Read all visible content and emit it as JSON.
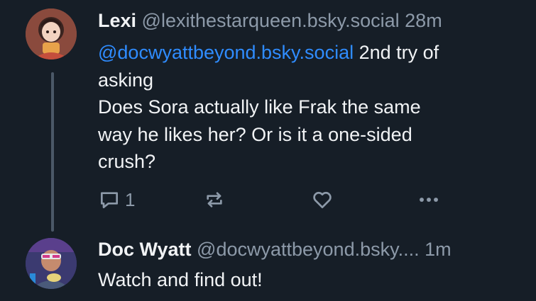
{
  "posts": [
    {
      "author": {
        "display_name": "Lexi",
        "handle": "@lexithestarqueen.bsky.social",
        "time": "28m"
      },
      "mention": "@docwyattbeyond.bsky.social",
      "text_line_1": " 2nd try of",
      "text_lines": [
        "asking",
        "Does Sora actually like Frak the same",
        "way he likes her? Or is it a one-sided",
        "crush?"
      ],
      "reply_count": "1",
      "icons": [
        "reply-icon",
        "repost-icon",
        "like-icon",
        "more-icon"
      ]
    },
    {
      "author": {
        "display_name": "Doc Wyatt",
        "handle": "@docwyattbeyond.bsky....",
        "time": "1m"
      },
      "text": "Watch and find out!"
    }
  ],
  "colors": {
    "background": "#161e27",
    "text": "#f1f3f5",
    "muted": "#8d9aa9",
    "link": "#2f8cff",
    "thread_line": "#4b5867"
  }
}
